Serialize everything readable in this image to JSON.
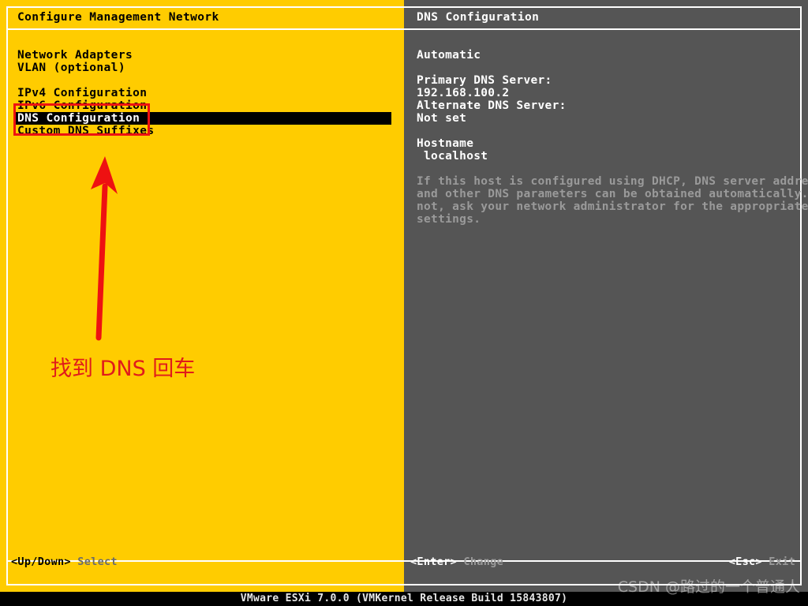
{
  "colors": {
    "yellow_pane": "#ffcc00",
    "gray_pane": "#555555",
    "selection_bg": "#000000",
    "selection_fg": "#ffffff",
    "annotation_red": "#ee1111",
    "annotation_text_red": "#e01b1b",
    "status_bar_bg": "#000000",
    "dim_text": "#9a9a9a"
  },
  "left_pane": {
    "title": "Configure Management Network",
    "menu_items": [
      {
        "label": "Network Adapters",
        "selected": false,
        "spacer_after": false
      },
      {
        "label": "VLAN (optional)",
        "selected": false,
        "spacer_after": true
      },
      {
        "label": "IPv4 Configuration",
        "selected": false,
        "spacer_after": false
      },
      {
        "label": "IPv6 Configuration",
        "selected": false,
        "spacer_after": false
      },
      {
        "label": "DNS Configuration",
        "selected": true,
        "spacer_after": false
      },
      {
        "label": "Custom DNS Suffixes",
        "selected": false,
        "spacer_after": false
      }
    ],
    "footer_key": "<Up/Down>",
    "footer_action": " Select"
  },
  "right_pane": {
    "title": "DNS Configuration",
    "lines": [
      {
        "text": "Automatic",
        "dim": false,
        "spacer_after": true
      },
      {
        "text": "Primary DNS Server:",
        "dim": false,
        "spacer_after": false
      },
      {
        "text": "192.168.100.2",
        "dim": false,
        "spacer_after": false
      },
      {
        "text": "Alternate DNS Server:",
        "dim": false,
        "spacer_after": false
      },
      {
        "text": "Not set",
        "dim": false,
        "spacer_after": true
      },
      {
        "text": "Hostname",
        "dim": false,
        "spacer_after": false
      },
      {
        "text": " localhost",
        "dim": false,
        "spacer_after": true
      },
      {
        "text": "If this host is configured using DHCP, DNS server addresses",
        "dim": true,
        "spacer_after": false
      },
      {
        "text": "and other DNS parameters can be obtained automatically. If",
        "dim": true,
        "spacer_after": false
      },
      {
        "text": "not, ask your network administrator for the appropriate",
        "dim": true,
        "spacer_after": false
      },
      {
        "text": "settings.",
        "dim": true,
        "spacer_after": false
      }
    ],
    "footer_enter_key": "<Enter>",
    "footer_enter_action": " Change",
    "footer_esc_key": "<Esc>",
    "footer_esc_action": " Exit"
  },
  "status_bar": {
    "text": "VMware ESXi 7.0.0 (VMKernel Release Build 15843807)"
  },
  "annotation": {
    "callout_text": "找到 DNS 回车",
    "highlight_box_target": "DNS Configuration"
  },
  "watermark": {
    "text": "CSDN @路过的一个普通人"
  }
}
